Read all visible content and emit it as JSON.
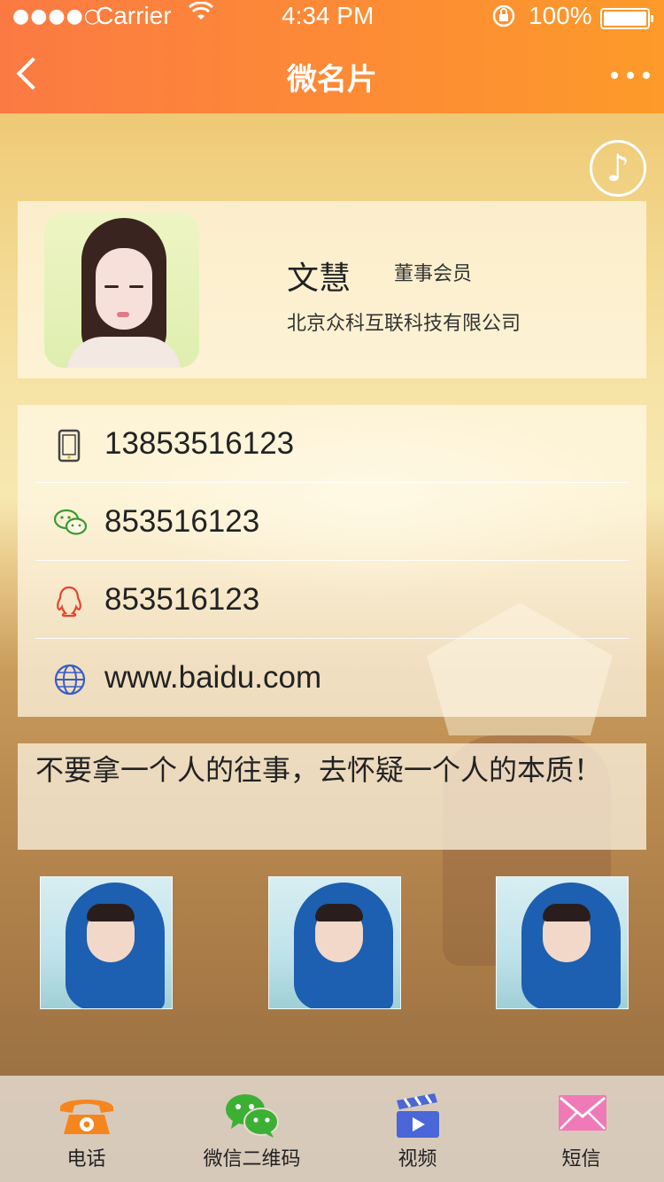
{
  "status_bar": {
    "signal": "●●●●○",
    "carrier": "Carrier",
    "time": "4:34 PM",
    "battery": "100%"
  },
  "navbar": {
    "title": "微名片"
  },
  "profile": {
    "name": "文慧",
    "role": "董事会员",
    "company": "北京众科互联科技有限公司"
  },
  "contacts": [
    {
      "icon": "phone-icon",
      "value": "13853516123"
    },
    {
      "icon": "wechat-icon",
      "value": "853516123"
    },
    {
      "icon": "qq-icon",
      "value": "853516123"
    },
    {
      "icon": "globe-icon",
      "value": "www.baidu.com"
    }
  ],
  "quote": "不要拿一个人的往事，去怀疑一个人的本质！",
  "tabs": [
    {
      "label": "电话",
      "icon": "telephone-icon",
      "color": "#f7851e"
    },
    {
      "label": "微信二维码",
      "icon": "wechat-icon",
      "color": "#3cb034"
    },
    {
      "label": "视频",
      "icon": "video-clapper-icon",
      "color": "#4a66d8"
    },
    {
      "label": "短信",
      "icon": "envelope-icon",
      "color": "#f07ab8"
    }
  ],
  "colors": {
    "navbar_start": "#fb7a43",
    "navbar_end": "#fd9a2a"
  }
}
